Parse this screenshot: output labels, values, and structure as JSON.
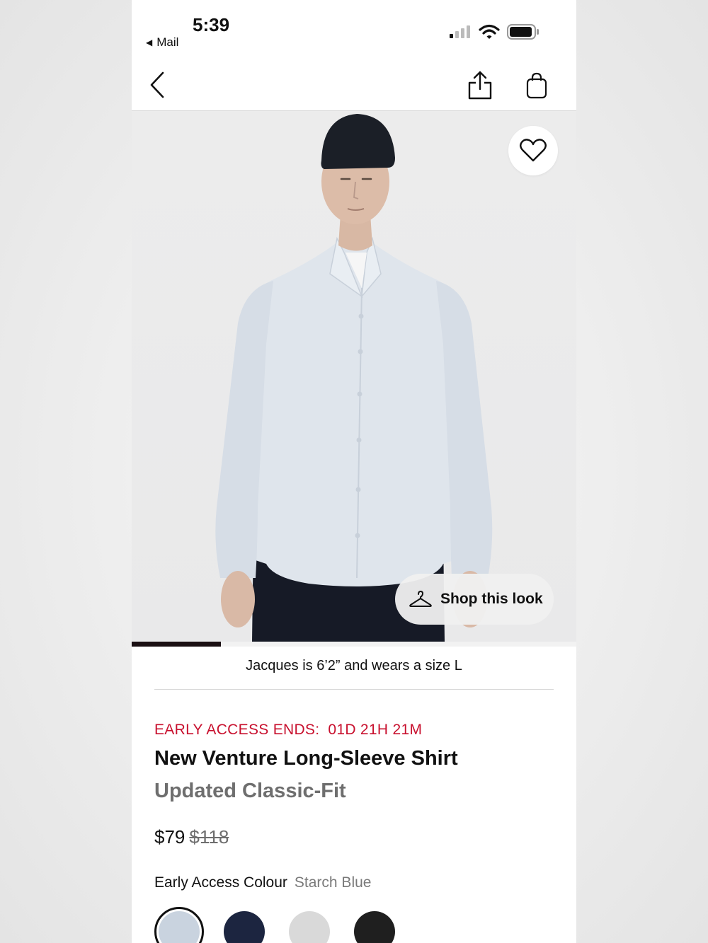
{
  "status_bar": {
    "time": "5:39",
    "back_app": "Mail"
  },
  "nav": {
    "back_icon": "chevron-left-icon",
    "share_icon": "share-icon",
    "bag_icon": "shopping-bag-icon"
  },
  "hero": {
    "favorite_icon": "heart-icon",
    "shop_this_look": "Shop this look",
    "carousel_progress": 0.2
  },
  "model_caption": "Jacques is 6’2” and wears a size L",
  "promo": {
    "label": "EARLY ACCESS ENDS:",
    "countdown": "01D 21H 21M",
    "color": "#c8102e"
  },
  "product": {
    "name": "New Venture Long-Sleeve Shirt",
    "fit": "Updated Classic-Fit",
    "price": "$79",
    "original_price": "$118"
  },
  "colour": {
    "label": "Early Access Colour",
    "selected": "Starch Blue",
    "swatches": [
      {
        "color": "#c9d3df",
        "selected": true
      },
      {
        "color": "#1c2540",
        "selected": false
      },
      {
        "color": "#d9d9d9",
        "selected": false
      },
      {
        "color": "#1f1f1f",
        "selected": false
      }
    ]
  }
}
